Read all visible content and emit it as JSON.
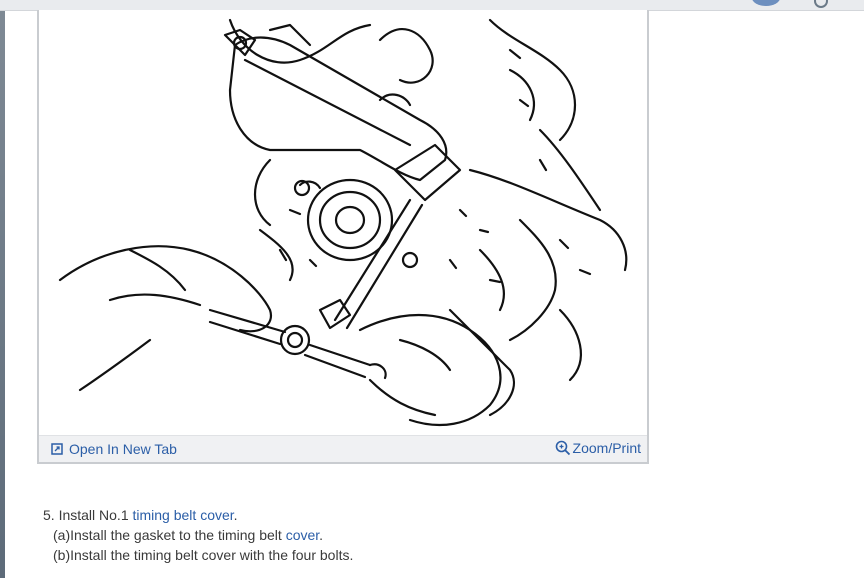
{
  "figure": {
    "open_tab_label": "Open In New Tab",
    "zoom_label": "Zoom/Print"
  },
  "steps": {
    "step5": {
      "prefix": "5. Install No.1 ",
      "link": "timing belt cover",
      "suffix": "."
    },
    "a": {
      "prefix": "(a)Install the gasket to the timing belt ",
      "link": "cover",
      "suffix": "."
    },
    "b": {
      "text": "(b)Install the timing belt cover with the four bolts."
    }
  },
  "colors": {
    "link": "#2b5ea7",
    "text": "#3a3a3a"
  },
  "icons": [
    "open-tab-icon",
    "zoom-icon"
  ]
}
